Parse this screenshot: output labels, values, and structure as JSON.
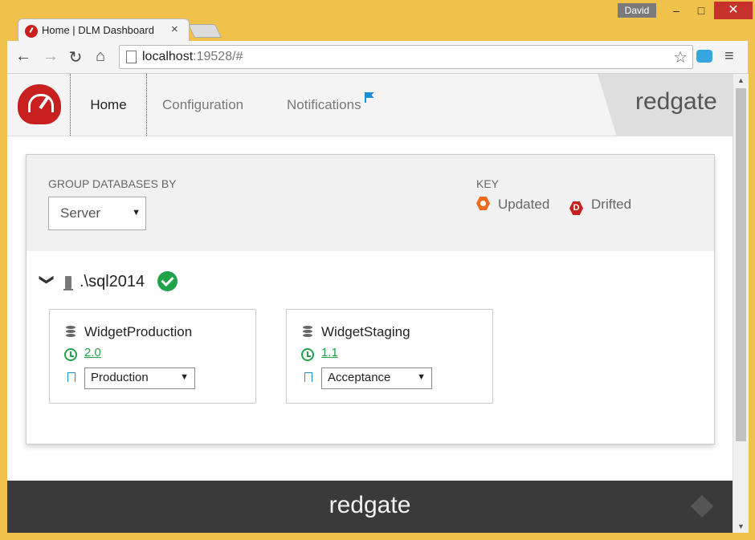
{
  "window": {
    "user": "David",
    "minimize": "–",
    "maximize": "□",
    "close": "✕"
  },
  "tab": {
    "title": "Home | DLM Dashboard",
    "close": "×"
  },
  "toolbar": {
    "back": "←",
    "forward": "→",
    "reload": "↻",
    "home": "⌂",
    "url_host": "localhost",
    "url_rest": ":19528/#",
    "star": "☆",
    "menu": "≡"
  },
  "nav": {
    "home": "Home",
    "configuration": "Configuration",
    "notifications": "Notifications",
    "brand": "redgate"
  },
  "filter": {
    "group_label": "GROUP DATABASES BY",
    "group_value": "Server",
    "key_label": "KEY",
    "key_updated": "Updated",
    "key_drifted": "Drifted",
    "drift_letter": "D"
  },
  "server": {
    "name": ".\\sql2014",
    "chevron": "❯"
  },
  "databases": [
    {
      "name": "WidgetProduction",
      "version": "2.0",
      "environment": "Production"
    },
    {
      "name": "WidgetStaging",
      "version": "1.1",
      "environment": "Acceptance"
    }
  ],
  "footer": {
    "brand": "redgate"
  },
  "caret": "▼",
  "scroll_up": "▲",
  "scroll_down": "▼"
}
